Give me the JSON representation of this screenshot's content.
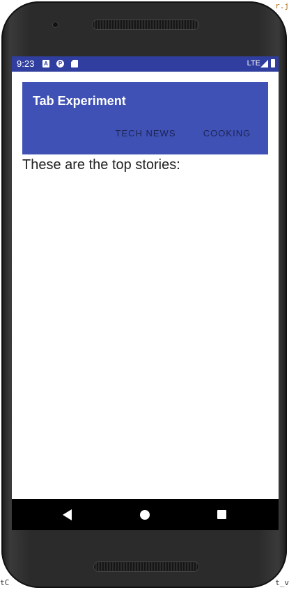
{
  "status_bar": {
    "time": "9:23",
    "icons": [
      "notification-a-icon",
      "notification-p-icon",
      "sd-card-icon"
    ],
    "network": "LTE",
    "color": "#303f9f"
  },
  "app_bar": {
    "title": "Tab Experiment",
    "color": "#3f51b5",
    "tabs": [
      {
        "label": "TECH NEWS"
      },
      {
        "label": "COOKING"
      }
    ]
  },
  "content": {
    "text": "These are the top stories:"
  },
  "nav_bar": {
    "buttons": [
      "back-icon",
      "home-icon",
      "recents-icon"
    ]
  },
  "background_fragments": {
    "top_right": "r.j",
    "bottom_left": "tC",
    "bottom_right": "t_v"
  }
}
